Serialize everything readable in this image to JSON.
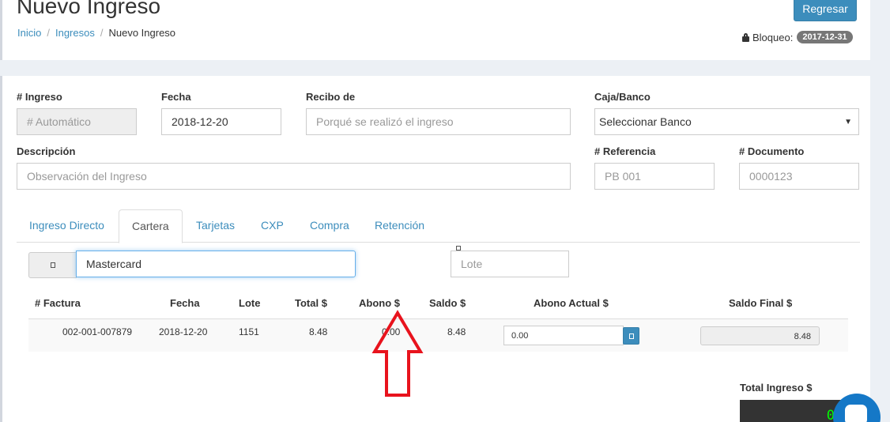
{
  "header": {
    "title": "Nuevo Ingreso",
    "back_button": "Regresar",
    "breadcrumb": [
      "Inicio",
      "Ingresos",
      "Nuevo Ingreso"
    ],
    "lock_label": "Bloqueo:",
    "lock_date": "2017-12-31"
  },
  "form": {
    "ingreso": {
      "label": "# Ingreso",
      "placeholder": "# Automático"
    },
    "fecha": {
      "label": "Fecha",
      "value": "2018-12-20"
    },
    "recibo": {
      "label": "Recibo de",
      "placeholder": "Porqué se realizó el ingreso"
    },
    "caja": {
      "label": "Caja/Banco",
      "value": "Seleccionar Banco"
    },
    "descripcion": {
      "label": "Descripción",
      "placeholder": "Observación del Ingreso"
    },
    "referencia": {
      "label": "# Referencia",
      "placeholder": "PB 001"
    },
    "documento": {
      "label": "# Documento",
      "placeholder": "0000123"
    }
  },
  "tabs": [
    "Ingreso Directo",
    "Cartera",
    "Tarjetas",
    "CXP",
    "Compra",
    "Retención"
  ],
  "active_tab": "Cartera",
  "cartera": {
    "search_value": "Mastercard",
    "lote_placeholder": "Lote",
    "columns": [
      "# Factura",
      "Fecha",
      "Lote",
      "Total $",
      "Abono $",
      "Saldo $",
      "Abono Actual $",
      "Saldo Final $"
    ],
    "rows": [
      {
        "factura": "002-001-007879",
        "fecha": "2018-12-20",
        "lote": "1151",
        "total": "8.48",
        "abono": "0.00",
        "saldo": "8.48",
        "abono_actual": "0.00",
        "saldo_final": "8.48"
      }
    ]
  },
  "total": {
    "label": "Total Ingreso $",
    "value": "0"
  },
  "colors": {
    "primary": "#3c8dbc",
    "annotation": "#e8131d",
    "total_text": "#00ff00"
  }
}
